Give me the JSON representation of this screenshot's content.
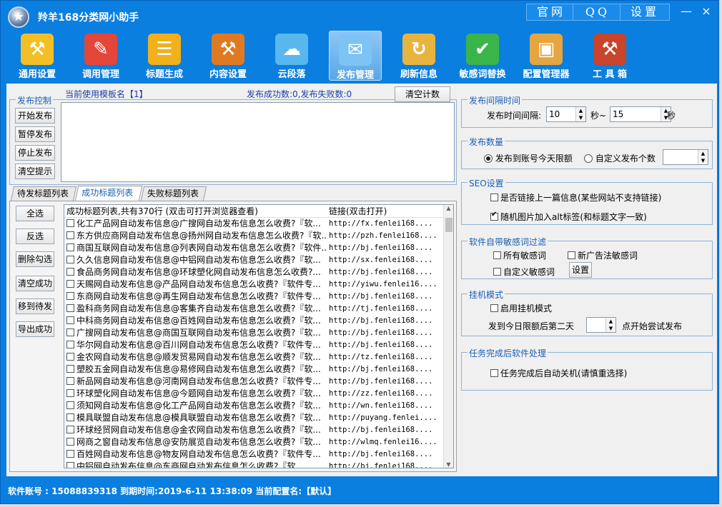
{
  "app": {
    "title": "羚羊168分类网小助手"
  },
  "topbar": {
    "official": "官网",
    "qq": "QQ",
    "settings": "设置",
    "minimize": "—",
    "close": "×"
  },
  "toolbar": [
    {
      "label": "通用设置",
      "icon": "tools-icon",
      "glyph": "⚒",
      "color": "#f2c026"
    },
    {
      "label": "调用管理",
      "icon": "edit-icon",
      "glyph": "✎",
      "color": "#e4463a"
    },
    {
      "label": "标题生成",
      "icon": "list-icon",
      "glyph": "☰",
      "color": "#f2b01a"
    },
    {
      "label": "内容设置",
      "icon": "folder-icon",
      "glyph": "⚒",
      "color": "#e07a22"
    },
    {
      "label": "云段落",
      "icon": "cloud-icon",
      "glyph": "☁",
      "color": "#58b8ee"
    },
    {
      "label": "发布管理",
      "icon": "publish-icon",
      "glyph": "✉",
      "color": "#7dc4f4"
    },
    {
      "label": "刷新信息",
      "icon": "refresh-icon",
      "glyph": "↻",
      "color": "#e8b440"
    },
    {
      "label": "敏感词替换",
      "icon": "check-shield-icon",
      "glyph": "✔",
      "color": "#39b54a"
    },
    {
      "label": "配置管理器",
      "icon": "box-icon",
      "glyph": "▣",
      "color": "#e5a540"
    },
    {
      "label": "工 具 箱",
      "icon": "toolbox-icon",
      "glyph": "⚒",
      "color": "#c8442a"
    }
  ],
  "publish": {
    "group_title": "发布控制",
    "template_label": "当前使用模板名【1】",
    "stats": "发布成功数:0,发布失败数:0",
    "clear_count": "清空计数",
    "buttons": [
      "开始发布",
      "暂停发布",
      "停止发布",
      "清空提示"
    ]
  },
  "tabs": [
    "待发标题列表",
    "成功标题列表",
    "失败标题列表"
  ],
  "side_buttons": [
    "全选",
    "反选",
    "删除勾选",
    "清空成功",
    "移到待发",
    "导出成功"
  ],
  "list": {
    "col1": "成功标题列表,共有370行 (双击可打开浏览器查看)",
    "col2": "链接(双击打开)",
    "rows": [
      [
        "化工产品网自动发布信息@广搜网自动发布信息怎么收费?『软...",
        "http://fx.fenlei168...."
      ],
      [
        "东方供应商网自动发布信息@扬州网自动发布信息怎么收费?『软...",
        "http://pzh.fenlei168...."
      ],
      [
        "商国互联网自动发布信息@列表网自动发布信息怎么收费?『软件...",
        "http://bj.fenlei168...."
      ],
      [
        "久久信息网自动发布信息@中铝网自动发布信息怎么收费?『软...",
        "http://sx.fenlei168...."
      ],
      [
        "食品商务网自动发布信息@环球塑化网自动发布信息怎么收费?...",
        "http://bj.fenlei168...."
      ],
      [
        "天赐网自动发布信息@产品网自动发布信息怎么收费?『软件专...",
        "http://yiwu.fenlei16...."
      ],
      [
        "东商网自动发布信息@再生网自动发布信息怎么收费?『软件专...",
        "http://bj.fenlei168...."
      ],
      [
        "盈科商务网自动发布信息@客集齐自动发布信息怎么收费?『软...",
        "http://tj.fenlei168...."
      ],
      [
        "中科商务网自动发布信息@百姓网自动发布信息怎么收费?『软...",
        "http://bj.fenlei168...."
      ],
      [
        "广搜网自动发布信息@商国互联网自动发布信息怎么收费?『软...",
        "http://bj.fenlei168...."
      ],
      [
        "华尔网自动发布信息@百川网自动发布信息怎么收费?『软件专...",
        "http://bj.fenlei168...."
      ],
      [
        "金农网自动发布信息@顺发贸易网自动发布信息怎么收费?『软...",
        "http://tz.fenlei168...."
      ],
      [
        "塑胶五金网自动发布信息@易修网自动发布信息怎么收费?『软...",
        "http://bj.fenlei168...."
      ],
      [
        "新品网自动发布信息@河南网自动发布信息怎么收费?『软件专...",
        "http://bj.fenlei168...."
      ],
      [
        "环球塑化网自动发布信息@今题网自动发布信息怎么收费?『软...",
        "http://zz.fenlei168...."
      ],
      [
        "须知网自动发布信息@化工产品网自动发布信息怎么收费?『软...",
        "http://wn.fenlei168...."
      ],
      [
        "模具联盟自动发布信息@模具联盟自动发布信息怎么收费?『软...",
        "http://puyang.fenlei...."
      ],
      [
        "环球经贸网自动发布信息@金农网自动发布信息怎么收费?『软...",
        "http://bj.fenlei168...."
      ],
      [
        "网商之窗自动发布信息@安防展览自动发布信息怎么收费?『软...",
        "http://wlmq.fenlei16...."
      ],
      [
        "百姓网自动发布信息@物友网自动发布信息怎么收费?『软件专...",
        "http://bj.fenlei168...."
      ],
      [
        "中铝网自动发布信息@东商网自动发布信息怎么收费?『软...",
        "http://bj.fenlei168...."
      ]
    ]
  },
  "interval": {
    "title": "发布间隔时间",
    "label": "发布时间间隔:",
    "min": "10",
    "tilde": "秒~",
    "max": "15",
    "unit": "秒"
  },
  "count": {
    "title": "发布数量",
    "opt1": "发布到账号今天限额",
    "opt2": "自定义发布个数",
    "custom_value": ""
  },
  "seo": {
    "title": "SEO设置",
    "opt1": "是否链接上一篇信息(某些网站不支持链接)",
    "opt2": "随机图片加入alt标签(和标题文字一致)"
  },
  "filter": {
    "title": "软件自带敏感词过滤",
    "opt1": "所有敏感词",
    "opt2": "新广告法敏感词",
    "opt3": "自定义敏感词",
    "settings": "设置"
  },
  "hangup": {
    "title": "挂机模式",
    "opt1": "启用挂机模式",
    "pre": "发到今日限额后第二天",
    "days": "",
    "post": "点开始尝试发布"
  },
  "finish": {
    "title": "任务完成后软件处理",
    "opt1": "任务完成后自动关机(请慎重选择)"
  },
  "status": {
    "text": "软件账号 : 15088839318  到期时间:2019-6-11 13:38:09  当前配置名:【默认】"
  }
}
